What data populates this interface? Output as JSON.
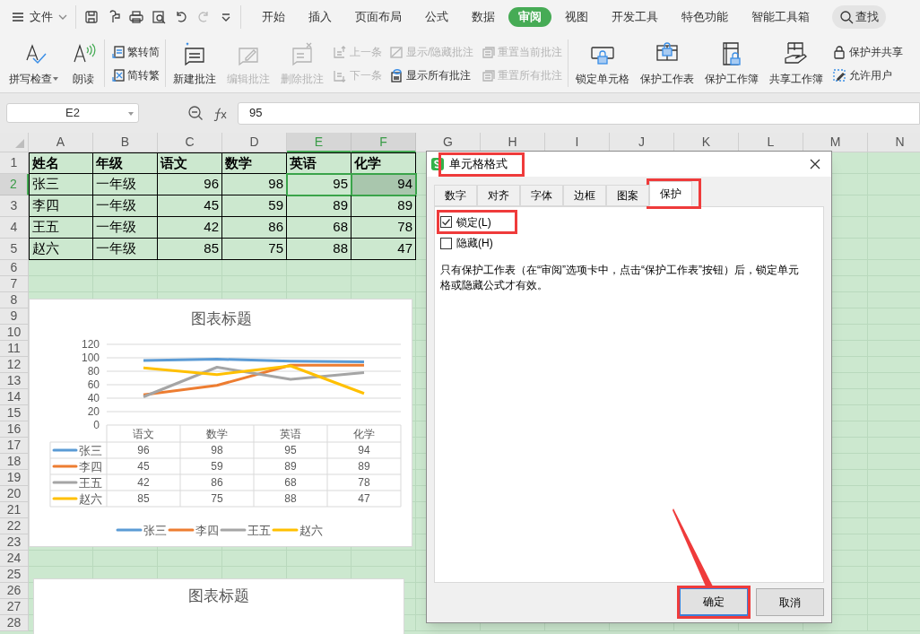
{
  "menu": {
    "file_label": "文件",
    "tabs": [
      {
        "label": "开始",
        "selected": false
      },
      {
        "label": "插入",
        "selected": false
      },
      {
        "label": "页面布局",
        "selected": false
      },
      {
        "label": "公式",
        "selected": false
      },
      {
        "label": "数据",
        "selected": false
      },
      {
        "label": "审阅",
        "selected": true
      },
      {
        "label": "视图",
        "selected": false
      },
      {
        "label": "开发工具",
        "selected": false
      },
      {
        "label": "特色功能",
        "selected": false
      },
      {
        "label": "智能工具箱",
        "selected": false
      }
    ],
    "search_label": "查找"
  },
  "ribbon": {
    "sections": [
      {
        "columns": [
          {
            "items": [
              {
                "label": "拼写检查",
                "disabled": false,
                "dropdown": true
              }
            ]
          },
          {
            "items": [
              {
                "label": "朗读",
                "disabled": false
              }
            ]
          }
        ]
      },
      {
        "columns": [
          {
            "items": [
              {
                "label": "繁转简",
                "disabled": false
              },
              {
                "label": "简转繁",
                "disabled": false
              }
            ]
          }
        ]
      },
      {
        "columns": [
          {
            "items": [
              {
                "label": "新建批注",
                "disabled": false
              }
            ]
          },
          {
            "items": [
              {
                "label": "编辑批注",
                "disabled": true
              }
            ]
          },
          {
            "items": [
              {
                "label": "删除批注",
                "disabled": true
              }
            ]
          },
          {
            "items": [
              {
                "label": "上一条",
                "disabled": true
              },
              {
                "label": "下一条",
                "disabled": true
              }
            ]
          },
          {
            "items": [
              {
                "label": "显示/隐藏批注",
                "disabled": true
              },
              {
                "label": "显示所有批注",
                "disabled": false
              }
            ]
          },
          {
            "items": [
              {
                "label": "重置当前批注",
                "disabled": true
              },
              {
                "label": "重置所有批注",
                "disabled": true
              }
            ]
          }
        ]
      },
      {
        "columns": [
          {
            "items": [
              {
                "label": "锁定单元格",
                "disabled": false
              }
            ]
          },
          {
            "items": [
              {
                "label": "保护工作表",
                "disabled": false
              }
            ]
          },
          {
            "items": [
              {
                "label": "保护工作簿",
                "disabled": false
              }
            ]
          },
          {
            "items": [
              {
                "label": "共享工作簿",
                "disabled": false
              }
            ]
          },
          {
            "items": [
              {
                "label": "保护并共享",
                "disabled": false
              },
              {
                "label": "允许用户",
                "disabled": false
              }
            ]
          }
        ]
      }
    ]
  },
  "formula_bar": {
    "cell_ref": "E2",
    "formula": "95"
  },
  "sheet": {
    "columns": [
      {
        "label": "A",
        "selected": false
      },
      {
        "label": "B",
        "selected": false
      },
      {
        "label": "C",
        "selected": false
      },
      {
        "label": "D",
        "selected": false
      },
      {
        "label": "E",
        "selected": true
      },
      {
        "label": "F",
        "selected": true
      },
      {
        "label": "G",
        "selected": false
      },
      {
        "label": "H",
        "selected": false
      },
      {
        "label": "I",
        "selected": false
      },
      {
        "label": "J",
        "selected": false
      },
      {
        "label": "K",
        "selected": false
      },
      {
        "label": "L",
        "selected": false
      },
      {
        "label": "M",
        "selected": false
      },
      {
        "label": "N",
        "selected": false
      }
    ],
    "rows": [
      {
        "number": "1",
        "selected": false,
        "kind": "header",
        "cells": [
          "姓名",
          "年级",
          "语文",
          "数学",
          "英语",
          "化学"
        ]
      },
      {
        "number": "2",
        "selected": true,
        "kind": "data",
        "cells": [
          "张三",
          "一年级",
          "96",
          "98",
          "95",
          "94"
        ]
      },
      {
        "number": "3",
        "selected": false,
        "kind": "data",
        "cells": [
          "李四",
          "一年级",
          "45",
          "59",
          "89",
          "89"
        ]
      },
      {
        "number": "4",
        "selected": false,
        "kind": "data",
        "cells": [
          "王五",
          "一年级",
          "42",
          "86",
          "68",
          "78"
        ]
      },
      {
        "number": "5",
        "selected": false,
        "kind": "data",
        "cells": [
          "赵六",
          "一年级",
          "85",
          "75",
          "88",
          "47"
        ]
      },
      {
        "number": "6",
        "selected": false
      },
      {
        "number": "7",
        "selected": false
      },
      {
        "number": "8",
        "selected": false
      },
      {
        "number": "9",
        "selected": false
      },
      {
        "number": "10",
        "selected": false
      },
      {
        "number": "11",
        "selected": false
      },
      {
        "number": "12",
        "selected": false
      },
      {
        "number": "13",
        "selected": false
      },
      {
        "number": "14",
        "selected": false
      },
      {
        "number": "15",
        "selected": false
      },
      {
        "number": "16",
        "selected": false
      },
      {
        "number": "17",
        "selected": false
      },
      {
        "number": "18",
        "selected": false
      },
      {
        "number": "19",
        "selected": false
      },
      {
        "number": "20",
        "selected": false
      },
      {
        "number": "21",
        "selected": false
      },
      {
        "number": "22",
        "selected": false
      },
      {
        "number": "23",
        "selected": false
      },
      {
        "number": "24",
        "selected": false
      },
      {
        "number": "25",
        "selected": false
      },
      {
        "number": "26",
        "selected": false
      },
      {
        "number": "27",
        "selected": false
      },
      {
        "number": "28",
        "selected": false
      }
    ]
  },
  "charts": [
    {
      "chart_data": {
        "type": "line",
        "title": "图表标题",
        "categories": [
          "语文",
          "数学",
          "英语",
          "化学"
        ],
        "series": [
          {
            "name": "张三",
            "color": "#5b9bd5",
            "values": [
              96,
              98,
              95,
              94
            ]
          },
          {
            "name": "李四",
            "color": "#ed7d31",
            "values": [
              45,
              59,
              89,
              89
            ]
          },
          {
            "name": "王五",
            "color": "#a5a5a5",
            "values": [
              42,
              86,
              68,
              78
            ]
          },
          {
            "name": "赵六",
            "color": "#ffc000",
            "values": [
              85,
              75,
              88,
              47
            ]
          }
        ],
        "ylim": [
          0,
          120
        ],
        "yticks": [
          0,
          20,
          40,
          60,
          80,
          100,
          120
        ],
        "grid": true,
        "legend": true
      },
      "data_table": {
        "rows": [
          {
            "label": "张三",
            "values": [
              "96",
              "98",
              "95",
              "94"
            ]
          },
          {
            "label": "李四",
            "values": [
              "45",
              "59",
              "89",
              "89"
            ]
          },
          {
            "label": "王五",
            "values": [
              "42",
              "86",
              "68",
              "78"
            ]
          },
          {
            "label": "赵六",
            "values": [
              "85",
              "75",
              "88",
              "47"
            ]
          }
        ]
      }
    },
    {
      "title": "图表标题"
    }
  ],
  "dialog": {
    "title": "单元格格式",
    "title_highlighted": true,
    "tabs": [
      {
        "label": "数字",
        "selected": false,
        "highlighted": false
      },
      {
        "label": "对齐",
        "selected": false,
        "highlighted": false
      },
      {
        "label": "字体",
        "selected": false,
        "highlighted": false
      },
      {
        "label": "边框",
        "selected": false,
        "highlighted": false
      },
      {
        "label": "图案",
        "selected": false,
        "highlighted": false
      },
      {
        "label": "保护",
        "selected": true,
        "highlighted": true
      }
    ],
    "options": [
      {
        "label": "锁定(L)",
        "checked": true,
        "highlighted": true
      },
      {
        "label": "隐藏(H)",
        "checked": false,
        "highlighted": false
      }
    ],
    "note": "只有保护工作表（在“审阅”选项卡中，点击“保护工作表”按钮）后，锁定单元格或隐藏公式才有效。",
    "buttons": [
      {
        "label": "确定",
        "focused": true,
        "highlighted": true
      },
      {
        "label": "取消",
        "focused": false,
        "highlighted": false
      }
    ]
  }
}
